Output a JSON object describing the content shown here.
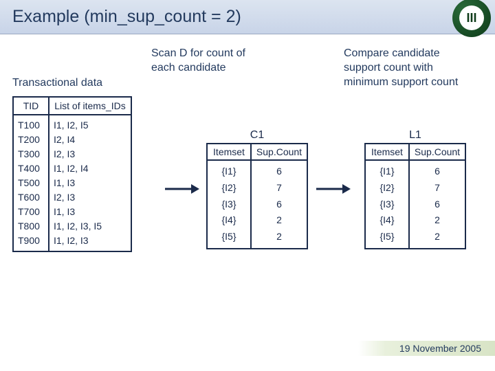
{
  "title": "Example (min_sup_count = 2)",
  "labels": {
    "transactional": "Transactional data",
    "step1": "Scan D for count of each candidate",
    "step2": "Compare candidate support count with minimum support count"
  },
  "trans_table": {
    "headers": {
      "tid": "TID",
      "items": "List of items_IDs"
    },
    "rows": [
      {
        "tid": "T100",
        "items": "I1, I2, I5"
      },
      {
        "tid": "T200",
        "items": "I2, I4"
      },
      {
        "tid": "T300",
        "items": "I2, I3"
      },
      {
        "tid": "T400",
        "items": "I1, I2, I4"
      },
      {
        "tid": "T500",
        "items": "I1, I3"
      },
      {
        "tid": "T600",
        "items": "I2, I3"
      },
      {
        "tid": "T700",
        "items": "I1, I3"
      },
      {
        "tid": "T800",
        "items": "I1, I2, I3, I5"
      },
      {
        "tid": "T900",
        "items": "I1, I2, I3"
      }
    ]
  },
  "c1": {
    "caption": "C1",
    "headers": {
      "itemset": "Itemset",
      "count": "Sup.Count"
    },
    "rows": [
      {
        "itemset": "{I1}",
        "count": "6"
      },
      {
        "itemset": "{I2}",
        "count": "7"
      },
      {
        "itemset": "{I3}",
        "count": "6"
      },
      {
        "itemset": "{I4}",
        "count": "2"
      },
      {
        "itemset": "{I5}",
        "count": "2"
      }
    ]
  },
  "l1": {
    "caption": "L1",
    "headers": {
      "itemset": "Itemset",
      "count": "Sup.Count"
    },
    "rows": [
      {
        "itemset": "{I1}",
        "count": "6"
      },
      {
        "itemset": "{I2}",
        "count": "7"
      },
      {
        "itemset": "{I3}",
        "count": "6"
      },
      {
        "itemset": "{I4}",
        "count": "2"
      },
      {
        "itemset": "{I5}",
        "count": "2"
      }
    ]
  },
  "footer": "19 November 2005"
}
